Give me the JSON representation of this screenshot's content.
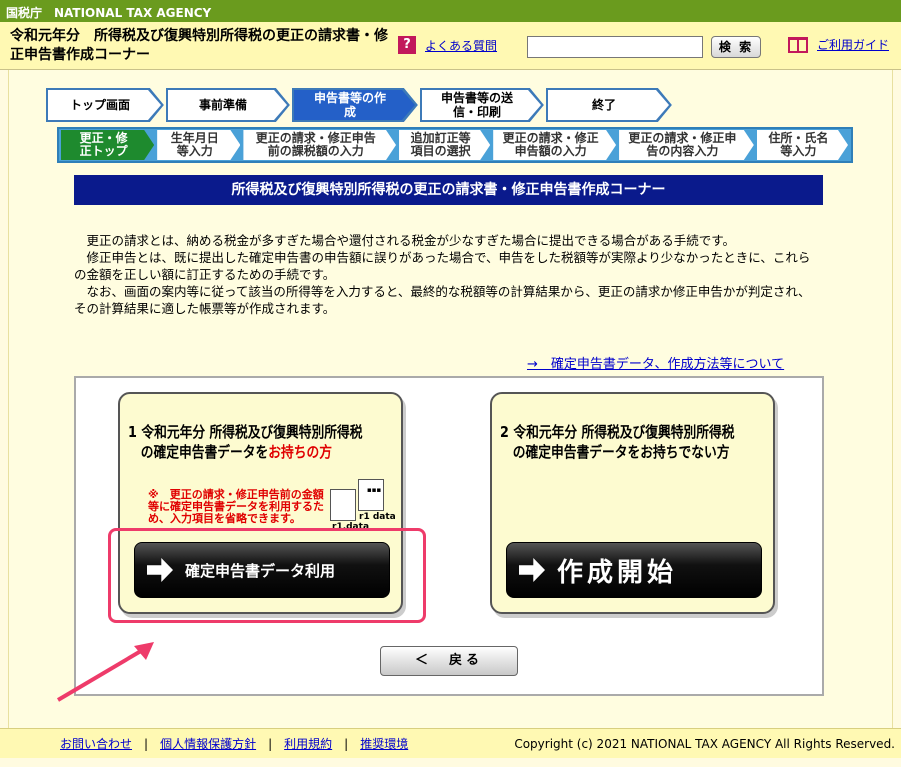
{
  "topbar": {
    "agency": "国税庁　NATIONAL TAX AGENCY"
  },
  "header": {
    "title": "令和元年分　所得税及び復興特別所得税の更正の請求書・修正申告書作成コーナー",
    "faq_link": "よくある質問",
    "search_button": "検 索",
    "search_placeholder": "",
    "guide_link": "ご利用ガイド"
  },
  "steps": [
    "トップ画面",
    "事前準備",
    "申告書等の作成",
    "申告書等の送信・印刷",
    "終了"
  ],
  "substeps": [
    "更正・修正トップ",
    "生年月日等入力",
    "更正の請求・修正申告前の課税額の入力",
    "追加訂正等項目の選択",
    "更正の請求・修正申告額の入力",
    "更正の請求・修正申告の内容入力",
    "住所・氏名等入力"
  ],
  "banner": "所得税及び復興特別所得税の更正の請求書・修正申告書作成コーナー",
  "intro": [
    "更正の請求とは、納める税金が多すぎた場合や還付される税金が少なすぎた場合に提出できる場合がある手続です。",
    "修正申告とは、既に提出した確定申告書の申告額に誤りがあった場合で、申告をした税額等が実際より少なかったときに、これらの金額を正しい額に訂正するための手続です。",
    "なお、画面の案内等に従って該当の所得等を入力すると、最終的な税額等の計算結果から、更正の請求か修正申告かが判定され、その計算結果に適した帳票等が作成されます。"
  ],
  "data_link": "→　確定申告書データ、作成方法等について",
  "card1": {
    "num": "1",
    "line1": "令和元年分 所得税及び復興特別所得税",
    "line2a": "の確定申告書データを",
    "line2b": "お持ちの方",
    "note_mark": "※",
    "note": "更正の請求・修正申告前の金額等に確定申告書データを利用するため、入力項目を省略できます。",
    "file1": "r1.data",
    "file2": "r1 data",
    "button": "確定申告書データ利用"
  },
  "card2": {
    "num": "2",
    "line1": "令和元年分 所得税及び復興特別所得税",
    "line2": "の確定申告書データをお持ちでない方",
    "button": "作成開始"
  },
  "back_button": "＜　戻る",
  "footer": {
    "links": [
      "お問い合わせ",
      "個人情報保護方針",
      "利用規約",
      "推奨環境"
    ],
    "separator": "|",
    "copyright": "Copyright (c) 2021 NATIONAL TAX AGENCY All Rights Reserved."
  }
}
